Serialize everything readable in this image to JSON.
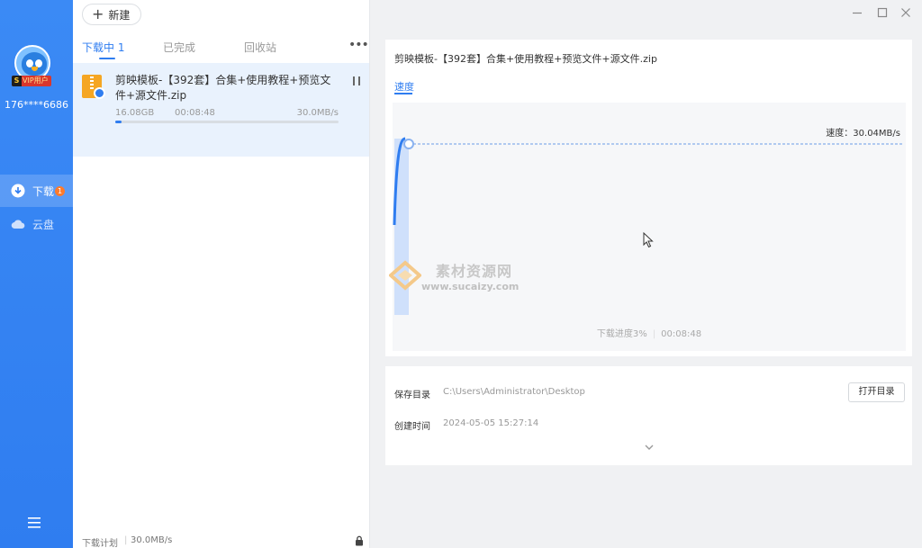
{
  "sidebar": {
    "vip_badge": "VIP用户",
    "vip_mark": "S",
    "user_phone": "176****6686",
    "nav": [
      {
        "label": "下载",
        "badge": "1",
        "icon": "download-icon",
        "active": true
      },
      {
        "label": "云盘",
        "icon": "cloud-icon",
        "active": false
      }
    ],
    "menu_icon": "menu-icon"
  },
  "toolbar": {
    "new_label": "新建"
  },
  "list": {
    "tabs": [
      "下载中 1",
      "已完成",
      "回收站"
    ],
    "more_label": "•••",
    "item": {
      "name": "剪映模板-【392套】合集+使用教程+预览文件+源文件.zip",
      "size": "16.08GB",
      "time_left": "00:08:48",
      "speed": "30.0MB/s",
      "progress": 0.03
    },
    "footer": {
      "plan_label": "下载计划",
      "rate": "30.0MB/s"
    }
  },
  "detail": {
    "file_title": "剪映模板-【392套】合集+使用教程+预览文件+源文件.zip",
    "speed_tab": "速度",
    "current_speed": "速度：30.04MB/s",
    "progress_text": "下载进度3%",
    "time_left": "00:08:48",
    "save_dir_label": "保存目录",
    "save_dir": "C:\\Users\\Administrator\\Desktop",
    "open_dir_label": "打开目录",
    "created_label": "创建时间",
    "created_time": "2024-05-05 15:27:14"
  },
  "watermark": {
    "cn": "素材资源网",
    "url": "www.sucaizy.com"
  },
  "colors": {
    "accent": "#2f7df0",
    "sidebar": "#3b8af5",
    "item_bg": "#e9f2fd"
  }
}
